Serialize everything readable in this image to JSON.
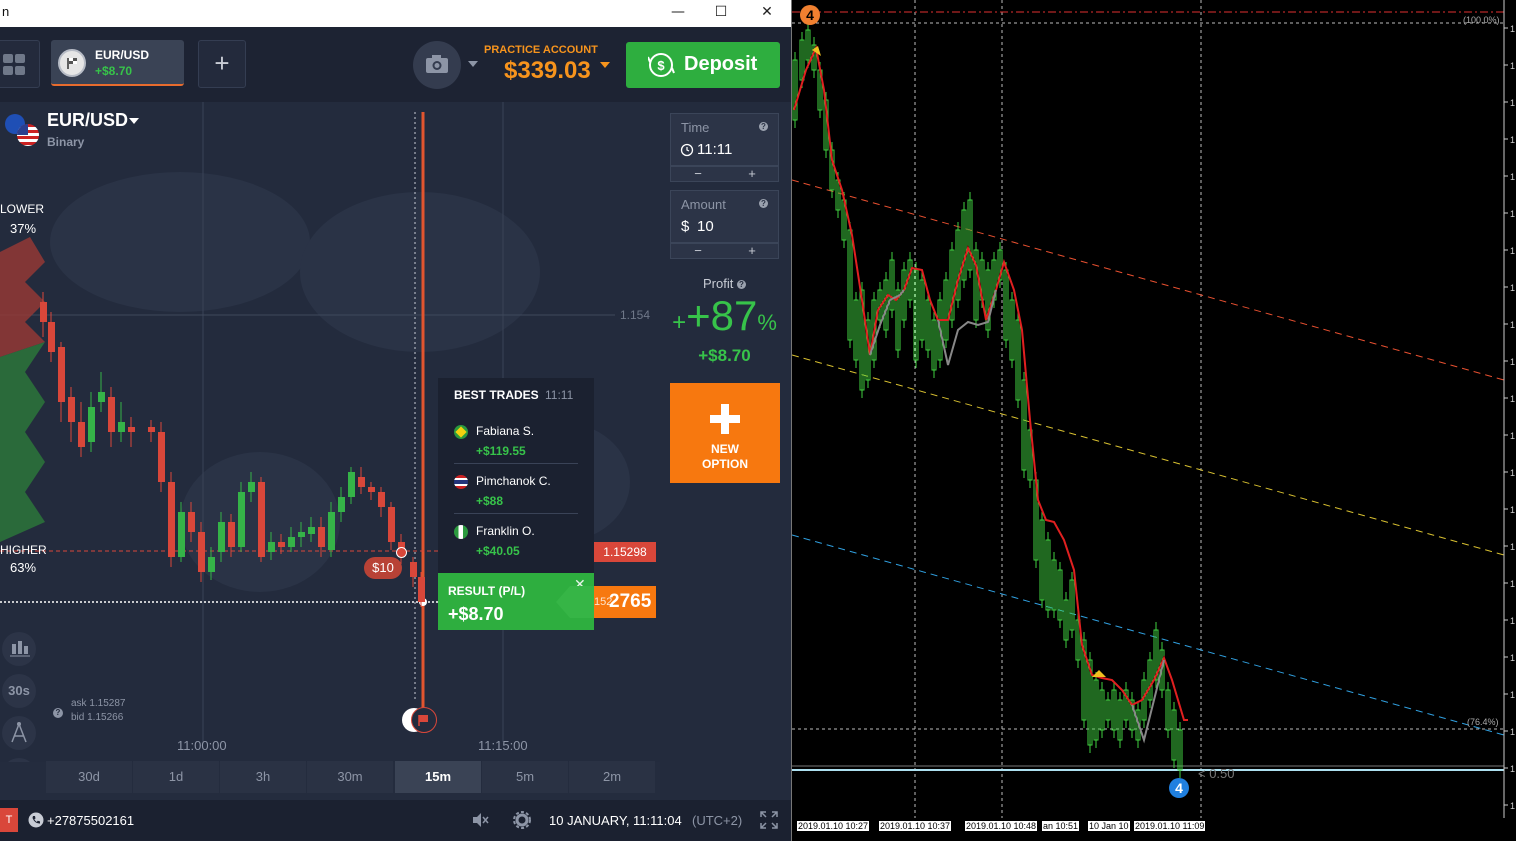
{
  "window": {
    "title_fragment": "n",
    "minimize": "—",
    "maximize": "☐",
    "close": "✕"
  },
  "topbar": {
    "asset_tab": {
      "name": "EUR/USD",
      "pl": "+$8.70"
    },
    "add_tab": "+",
    "account_label": "PRACTICE ACCOUNT",
    "balance": "$339.03",
    "deposit_label": "Deposit"
  },
  "asset": {
    "name": "EUR/USD",
    "type": "Binary"
  },
  "sentiment": {
    "lower_label": "LOWER",
    "lower_pct": "37%",
    "higher_label": "HIGHER",
    "higher_pct": "63%"
  },
  "chart": {
    "price_level_label": "1.154",
    "current_price_tag": "1.15298",
    "bet_label": "$10",
    "ask": "ask 1.15287",
    "bid": "bid 1.15266",
    "x_labels": [
      "11:00:00",
      "11:15:00"
    ],
    "tool_30s": "30s"
  },
  "timeframes": [
    "30d",
    "1d",
    "3h",
    "30m",
    "15m",
    "5m",
    "2m"
  ],
  "active_timeframe": "15m",
  "side": {
    "time_label": "Time",
    "time_value": "11:11",
    "amount_label": "Amount",
    "amount_currency": "$",
    "amount_value": "10",
    "minus": "−",
    "plus": "+",
    "profit_label": "Profit",
    "profit_pct": "+87",
    "profit_pct_sign": "%",
    "profit_amount": "+$8.70",
    "new_option_line1": "NEW",
    "new_option_line2": "OPTION"
  },
  "best_trades": {
    "title": "BEST TRADES",
    "time": "11:11",
    "items": [
      {
        "name": "Fabiana S.",
        "amount": "+$119.55",
        "country": "brazil"
      },
      {
        "name": "Pimchanok C.",
        "amount": "+$88",
        "country": "thailand"
      },
      {
        "name": "Franklin O.",
        "amount": "+$40.05",
        "country": "nigeria"
      }
    ]
  },
  "result": {
    "title": "RESULT (P/L)",
    "value": "+$8.70",
    "close": "✕"
  },
  "price_tag": {
    "prefix": "152",
    "suffix": "2765"
  },
  "bottombar": {
    "phone": "+27875502161",
    "datetime": "10 JANUARY, 11:11:04",
    "timezone": "(UTC+2)"
  },
  "mt": {
    "top_marker": "4",
    "bottom_marker": "4",
    "fib_top": "(100.0%)",
    "fib_mid": "(76.4%)",
    "price_note": "< 0.50",
    "dates": [
      "2019.01.10 10:27",
      "2019.01.10 10:37",
      "2019.01.10 10:48",
      "an 10:51",
      "10 Jan 10",
      "2019.01.10 11:09"
    ],
    "axis_digit": "1"
  }
}
